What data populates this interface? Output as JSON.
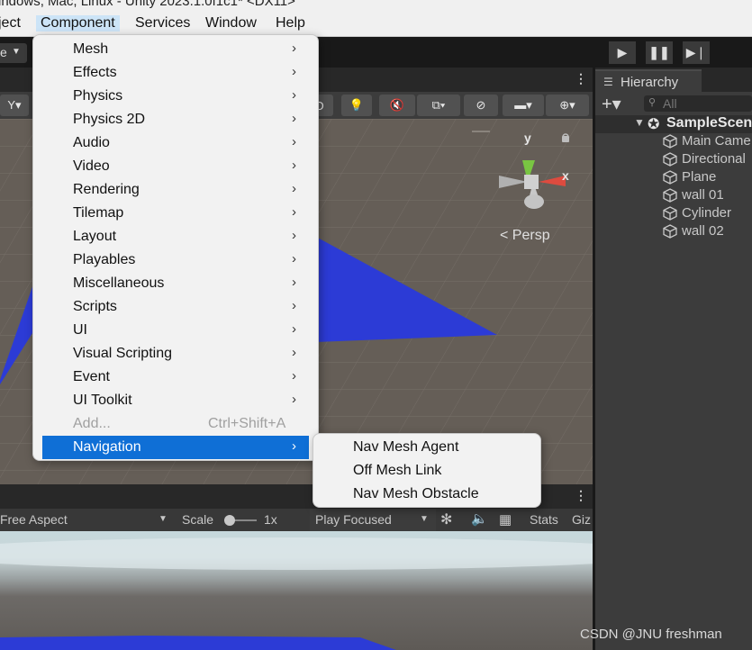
{
  "window_title": "indows, Mac, Linux - Unity 2023.1.0f1c1* <DX11>",
  "menubar": [
    "ject",
    "Component",
    "Services",
    "Window",
    "Help"
  ],
  "toolbar": {
    "layout_dropdown": "e"
  },
  "component_menu": {
    "items": [
      {
        "label": "Mesh"
      },
      {
        "label": "Effects"
      },
      {
        "label": "Physics"
      },
      {
        "label": "Physics 2D"
      },
      {
        "label": "Audio"
      },
      {
        "label": "Video"
      },
      {
        "label": "Rendering"
      },
      {
        "label": "Tilemap"
      },
      {
        "label": "Layout"
      },
      {
        "label": "Playables"
      },
      {
        "label": "Miscellaneous"
      },
      {
        "label": "Scripts"
      },
      {
        "label": "UI"
      },
      {
        "label": "Visual Scripting"
      },
      {
        "label": "Event"
      },
      {
        "label": "UI Toolkit"
      }
    ],
    "add_label": "Add...",
    "add_shortcut": "Ctrl+Shift+A",
    "selected_label": "Navigation"
  },
  "navigation_submenu": [
    "Nav Mesh Agent",
    "Off Mesh Link",
    "Nav Mesh Obstacle"
  ],
  "scene": {
    "gizmo_axis_y": "y",
    "gizmo_axis_x": "x",
    "projection_label": "Persp",
    "toolbar_icons": [
      "lighting-icon",
      "audio-mute-icon",
      "effects-icon",
      "visibility-icon",
      "camera-icon",
      "gizmos-icon"
    ]
  },
  "game": {
    "aspect": "Free Aspect",
    "scale_label": "Scale",
    "scale_value": "1x",
    "play_mode": "Play Focused",
    "stats": "Stats",
    "gizmos": "Giz"
  },
  "hierarchy": {
    "tab": "Hierarchy",
    "search_placeholder": "All",
    "scene": "SampleScen",
    "objects": [
      "Main Came",
      "Directional",
      "Plane",
      "wall 01",
      "Cylinder",
      "wall 02"
    ]
  },
  "watermark": "CSDN @JNU freshman",
  "colors": {
    "selection": "#0f6fd6",
    "menu_bg": "#f2f2f2",
    "plane_blue": "#2c3bd6",
    "editor_bg": "#3c3c3c"
  }
}
